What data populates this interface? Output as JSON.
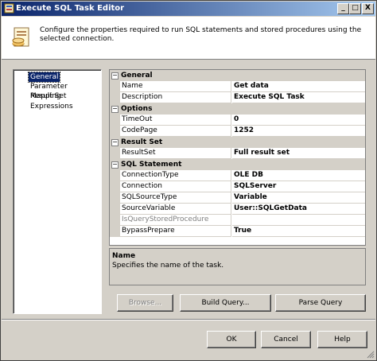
{
  "window": {
    "title": "Execute SQL Task Editor",
    "controls": {
      "minimize": "_",
      "maximize": "□",
      "close": "X"
    }
  },
  "header": {
    "icon": "sql-task-icon",
    "description": "Configure the properties required to run SQL statements and stored procedures using the selected connection."
  },
  "nav": {
    "items": [
      {
        "label": "General",
        "selected": true
      },
      {
        "label": "Parameter Mapping",
        "selected": false
      },
      {
        "label": "Result Set",
        "selected": false
      },
      {
        "label": "Expressions",
        "selected": false
      }
    ]
  },
  "properties": {
    "groups": [
      {
        "label": "General",
        "rows": [
          {
            "name": "Name",
            "value": "Get data"
          },
          {
            "name": "Description",
            "value": "Execute SQL Task"
          }
        ]
      },
      {
        "label": "Options",
        "rows": [
          {
            "name": "TimeOut",
            "value": "0"
          },
          {
            "name": "CodePage",
            "value": "1252"
          }
        ]
      },
      {
        "label": "Result Set",
        "rows": [
          {
            "name": "ResultSet",
            "value": "Full result set"
          }
        ]
      },
      {
        "label": "SQL Statement",
        "rows": [
          {
            "name": "ConnectionType",
            "value": "OLE DB"
          },
          {
            "name": "Connection",
            "value": "SQLServer"
          },
          {
            "name": "SQLSourceType",
            "value": "Variable"
          },
          {
            "name": "SourceVariable",
            "value": "User::SQLGetData"
          },
          {
            "name": "IsQueryStoredProcedure",
            "value": ""
          },
          {
            "name": "BypassPrepare",
            "value": "True"
          }
        ]
      }
    ],
    "collapse_glyph": "⊟"
  },
  "help": {
    "title": "Name",
    "text": "Specifies the name of the task."
  },
  "actions": {
    "browse": "Browse...",
    "build_query": "Build Query...",
    "parse_query": "Parse Query"
  },
  "footer": {
    "ok": "OK",
    "cancel": "Cancel",
    "help": "Help"
  },
  "colors": {
    "title_start": "#0a246a",
    "title_end": "#a6caf0",
    "face": "#d4d0c8",
    "selection": "#0a246a"
  }
}
